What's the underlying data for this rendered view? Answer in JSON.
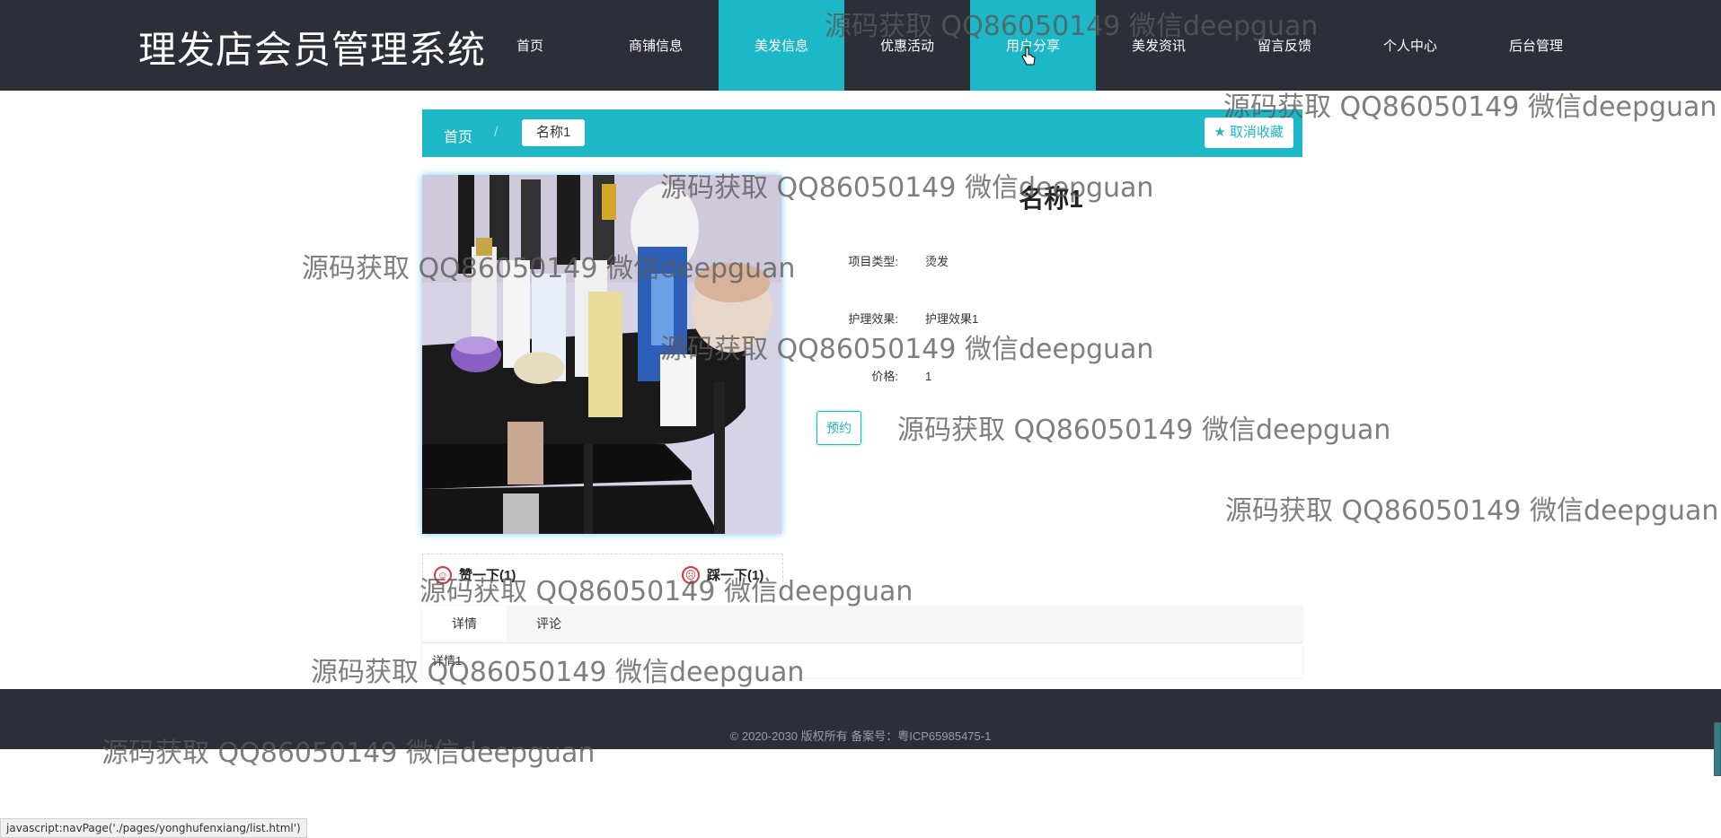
{
  "header": {
    "title": "理发店会员管理系统",
    "nav": [
      {
        "label": "首页",
        "active": false
      },
      {
        "label": "商铺信息",
        "active": false
      },
      {
        "label": "美发信息",
        "active": true
      },
      {
        "label": "优惠活动",
        "active": false
      },
      {
        "label": "用户分享",
        "active": false
      },
      {
        "label": "美发资讯",
        "active": false
      },
      {
        "label": "留言反馈",
        "active": false
      },
      {
        "label": "个人中心",
        "active": false
      },
      {
        "label": "后台管理",
        "active": false
      }
    ]
  },
  "breadcrumb": {
    "home": "首页",
    "separator": "/",
    "current": "名称1"
  },
  "favorite_button": "取消收藏",
  "product": {
    "title": "名称1",
    "fields": [
      {
        "label": "项目类型:",
        "value": "烫发"
      },
      {
        "label": "护理效果:",
        "value": "护理效果1"
      },
      {
        "label": "价格:",
        "value": "1"
      }
    ],
    "book_button": "预约"
  },
  "votes": {
    "like": "赞一下(1)",
    "dislike": "踩一下(1)"
  },
  "tabs": {
    "items": [
      "详情",
      "评论"
    ],
    "content": "详情1"
  },
  "footer": {
    "copyright": "© 2020-2030 版权所有 备案号：粤ICP65985475-1"
  },
  "status_bar": "javascript:navPage('./pages/yonghufenxiang/list.html')",
  "watermark": "源码获取 QQ86050149 微信deepguan",
  "colors": {
    "header_bg": "#2c2f38",
    "accent": "#1db8c8",
    "footer_bg": "#2c2f38"
  }
}
